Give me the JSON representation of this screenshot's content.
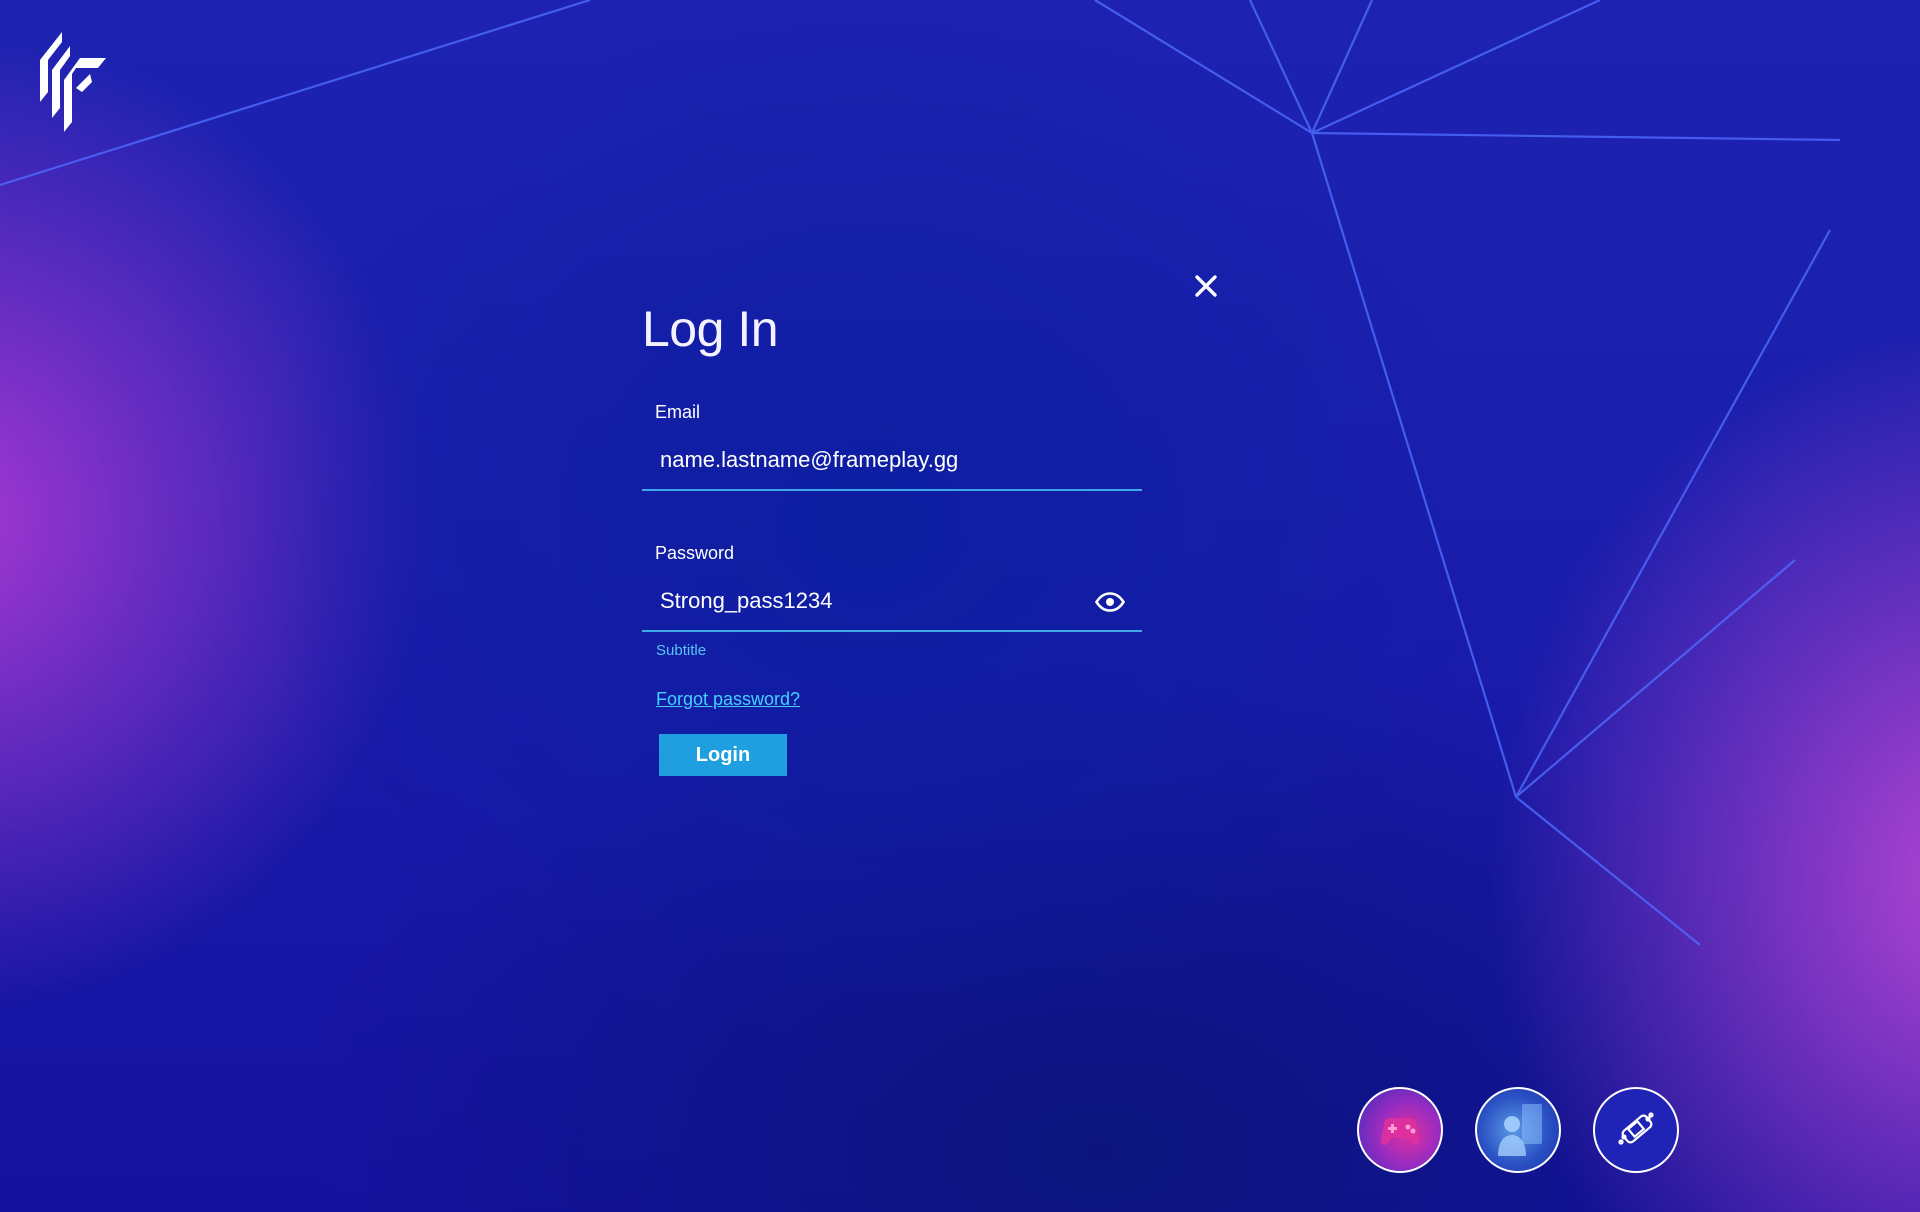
{
  "login": {
    "title": "Log In",
    "email_label": "Email",
    "email_value": "name.lastname@frameplay.gg",
    "password_label": "Password",
    "password_value": "Strong_pass1234",
    "helper_text": "Subtitle",
    "forgot_link": "Forgot password?",
    "login_button": "Login"
  },
  "icons": {
    "logo": "frameplay-logo",
    "close": "close-icon",
    "password_toggle": "eye-icon"
  },
  "avatars": [
    {
      "icon": "gamepad-avatar"
    },
    {
      "icon": "player-avatar"
    },
    {
      "icon": "bandage-avatar"
    }
  ],
  "colors": {
    "accent": "#1f9fe0",
    "link": "#45d0ff",
    "underline": "#3fa9e8",
    "background": "#1a1eac",
    "glow": "#b03ad6"
  }
}
